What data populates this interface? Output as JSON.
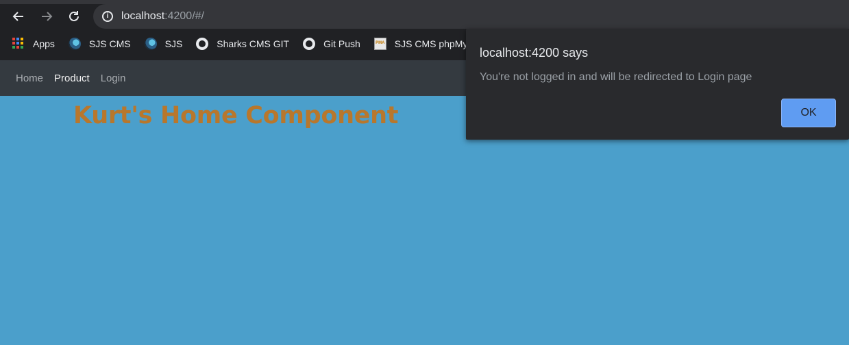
{
  "browser": {
    "url_host": "localhost",
    "url_rest": ":4200/#/",
    "back_icon": "arrow-left-icon",
    "forward_icon": "arrow-right-icon",
    "reload_icon": "reload-icon",
    "site_info_icon": "info-icon"
  },
  "bookmarks": [
    {
      "label": "Apps",
      "icon": "apps-grid-icon"
    },
    {
      "label": "SJS CMS",
      "icon": "shark-icon"
    },
    {
      "label": "SJS",
      "icon": "shark-icon"
    },
    {
      "label": "Sharks CMS GIT",
      "icon": "github-icon"
    },
    {
      "label": "Git Push",
      "icon": "github-icon"
    },
    {
      "label": "SJS CMS phpMy/",
      "icon": "phpmyadmin-icon"
    }
  ],
  "app_nav": {
    "items": [
      "Home",
      "Product",
      "Login"
    ],
    "active": "Product"
  },
  "page": {
    "heading": "Kurt's Home Component"
  },
  "dialog": {
    "title": "localhost:4200 says",
    "message": "You're not logged in and will be redirected to Login page",
    "ok_label": "OK"
  },
  "colors": {
    "page_background": "#4b9fcb",
    "heading": "#b8772c",
    "navbar": "#343a40",
    "ok_button": "#5f9cf2"
  }
}
